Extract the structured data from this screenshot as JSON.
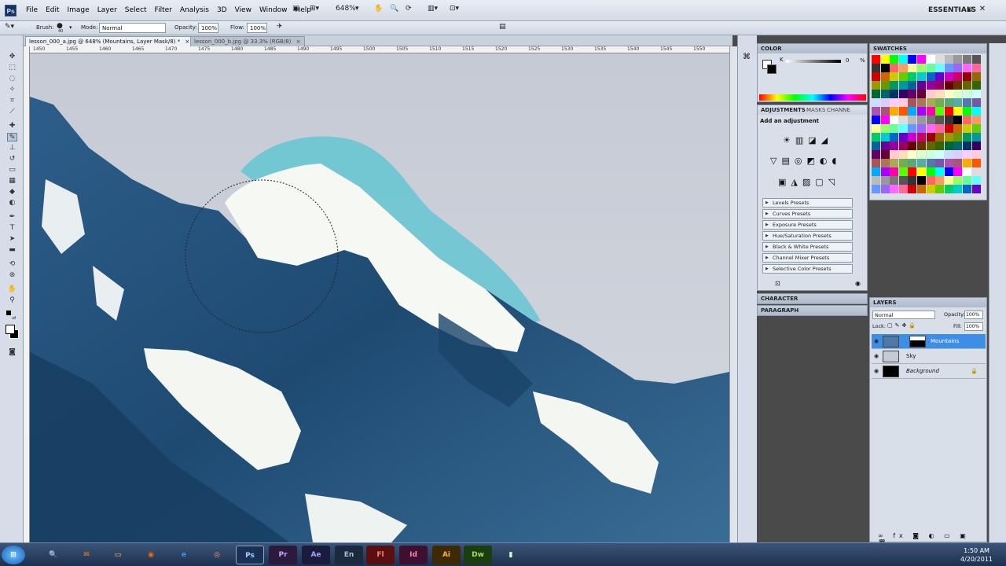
{
  "app": {
    "logo": "Ps",
    "menus": [
      "File",
      "Edit",
      "Image",
      "Layer",
      "Select",
      "Filter",
      "Analysis",
      "3D",
      "View",
      "Window",
      "Help"
    ],
    "zoom": "648%",
    "workspace": "ESSENTIALS"
  },
  "options": {
    "brush_label": "Brush:",
    "brush_size": "40",
    "mode_label": "Mode:",
    "mode_value": "Normal",
    "opacity_label": "Opacity:",
    "opacity_value": "100%",
    "flow_label": "Flow:",
    "flow_value": "100%"
  },
  "documents": {
    "tabs": [
      "lesson_000_a.jpg @ 648% (Mountains, Layer Mask/8) *",
      "lesson_000_b.jpg @ 33.3% (RGB/8)"
    ]
  },
  "ruler": {
    "labels": [
      "1450",
      "1455",
      "1460",
      "1465",
      "1470",
      "1475",
      "1480",
      "1485",
      "1490",
      "1495",
      "1500",
      "1505",
      "1510",
      "1515",
      "1520",
      "1525",
      "1530",
      "1535",
      "1540",
      "1545",
      "1550"
    ]
  },
  "panels": {
    "color": {
      "title": "COLOR",
      "value": "0",
      "unit": "%"
    },
    "swatches": {
      "title": "SWATCHES"
    },
    "adjustments": {
      "tab1": "ADJUSTMENTS",
      "tab2": "MASKS",
      "tab3": "CHANNE",
      "subtitle": "Add an adjustment",
      "presets": [
        "Levels Presets",
        "Curves Presets",
        "Exposure Presets",
        "Hue/Saturation Presets",
        "Black & White Presets",
        "Channel Mixer Presets",
        "Selective Color Presets"
      ]
    },
    "character": {
      "title": "CHARACTER"
    },
    "paragraph": {
      "title": "PARAGRAPH"
    },
    "layers": {
      "title": "LAYERS",
      "blend_mode": "Normal",
      "opacity_label": "Opacity:",
      "opacity_value": "100%",
      "lock_label": "Lock:",
      "fill_label": "Fill:",
      "fill_value": "100%",
      "items": [
        "Mountains",
        "Sky",
        "Background"
      ]
    }
  },
  "taskbar": {
    "apps": [
      "Pr",
      "Ae",
      "En",
      "Fl",
      "Id",
      "Ai",
      "Dw"
    ],
    "ps": "Ps",
    "time": "1:50 AM",
    "date": "4/20/2011"
  },
  "colors": {
    "accent": "#3d8ee6",
    "mask_overlay": "#6fc6d3",
    "snow": "#f6f8f4",
    "rock": "#1f4f79"
  }
}
